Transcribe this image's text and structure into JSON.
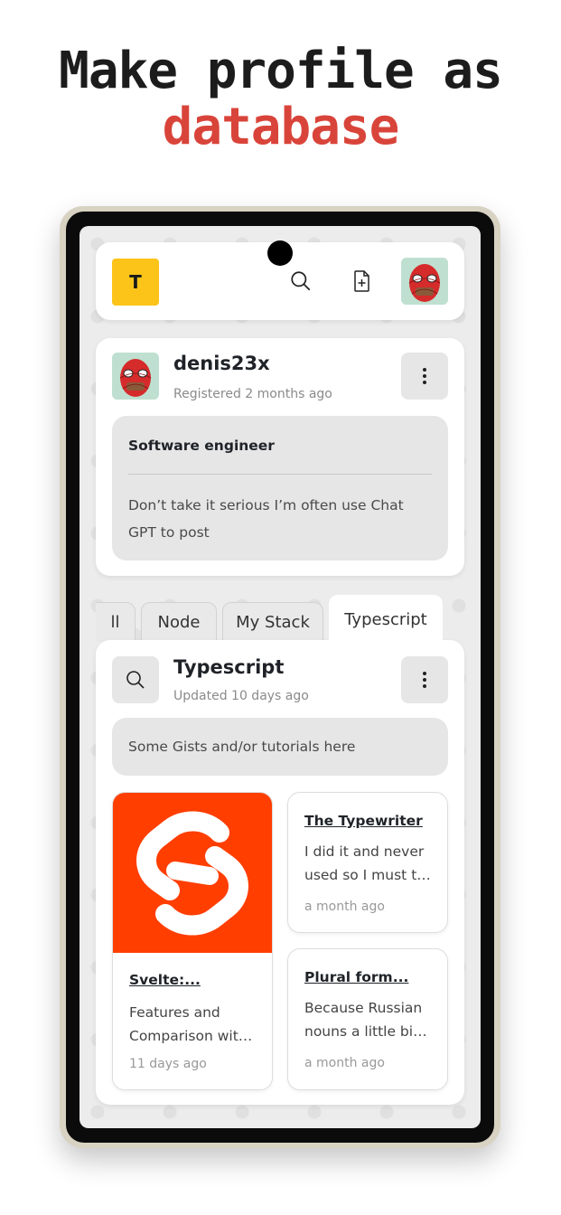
{
  "headline": {
    "line1": "Make profile as",
    "line2": "database"
  },
  "topbar": {
    "logo_letter": "T",
    "icons": [
      "search-icon",
      "add-file-icon",
      "avatar"
    ]
  },
  "profile": {
    "username": "denis23x",
    "registered": "Registered 2 months ago",
    "bio_title": "Software engineer",
    "bio_text_line1": "Don’t take it serious I’m often use Chat",
    "bio_text_line2": "GPT to post"
  },
  "tabs": [
    {
      "label": "ll"
    },
    {
      "label": "Node"
    },
    {
      "label": "My Stack"
    },
    {
      "label": "Typescript",
      "active": true
    }
  ],
  "category": {
    "title": "Typescript",
    "updated": "Updated 10 days ago",
    "description": "Some Gists and/or tutorials here"
  },
  "posts": [
    {
      "title": "Svelte:...",
      "text_line1": "Features and",
      "text_line2": "Comparison wit…",
      "date": "11 days ago"
    },
    {
      "title": "The Typewriter",
      "text_line1": "I did it and never",
      "text_line2": "used so I must t…",
      "date": "a month ago"
    },
    {
      "title": "Plural form...",
      "text_line1": "Because Russian",
      "text_line2": "nouns a little bi…",
      "date": "a month ago"
    }
  ],
  "colors": {
    "accent_red": "#d9443a",
    "logo_yellow": "#fcc419",
    "svelte_orange": "#ff3e00"
  }
}
